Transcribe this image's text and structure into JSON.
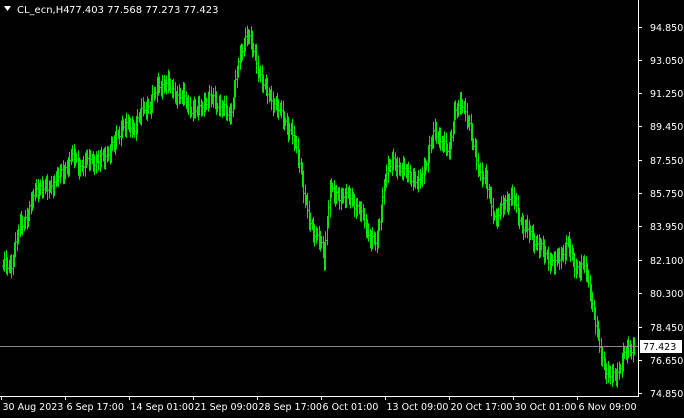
{
  "window": {
    "symbol_label": "CL_ecn,H4",
    "ohlc_label": "77.403 77.568 77.273 77.423",
    "menu_icon": "triangle-down-icon"
  },
  "colors": {
    "background": "#000000",
    "bars": "#00e600",
    "axis": "#ffffff",
    "text": "#ffffff",
    "price_line": "#8c8c8c",
    "price_tag_bg": "#ffffff",
    "price_tag_text": "#000000"
  },
  "price_tag": {
    "value": 77.423,
    "label": "77.423"
  },
  "chart_data": {
    "type": "bar",
    "instrument": "CL_ecn",
    "timeframe": "H4",
    "y_ticks": [
      94.85,
      93.05,
      91.25,
      89.45,
      87.55,
      85.75,
      83.95,
      82.1,
      80.3,
      78.45,
      76.65,
      74.85
    ],
    "y_tick_labels": [
      "94.850",
      "93.050",
      "91.250",
      "89.450",
      "87.550",
      "85.750",
      "83.950",
      "82.100",
      "80.300",
      "78.450",
      "76.650",
      "74.850"
    ],
    "x_tick_labels": [
      "30 Aug 2023",
      "6 Sep 17:00",
      "14 Sep 01:00",
      "21 Sep 09:00",
      "28 Sep 17:00",
      "6 Oct 01:00",
      "13 Oct 09:00",
      "20 Oct 17:00",
      "30 Oct 01:00",
      "6 Nov 09:00"
    ],
    "ylim": [
      74.7,
      96.3
    ],
    "close_anchors": [
      [
        0,
        81.8
      ],
      [
        6,
        81.9
      ],
      [
        12,
        84.0
      ],
      [
        18,
        84.6
      ],
      [
        24,
        86.1
      ],
      [
        32,
        86.0
      ],
      [
        38,
        86.5
      ],
      [
        44,
        87.0
      ],
      [
        50,
        87.8
      ],
      [
        56,
        87.2
      ],
      [
        62,
        87.6
      ],
      [
        70,
        87.5
      ],
      [
        80,
        88.4
      ],
      [
        86,
        89.5
      ],
      [
        94,
        89.3
      ],
      [
        100,
        90.2
      ],
      [
        106,
        90.6
      ],
      [
        112,
        91.6
      ],
      [
        118,
        91.8
      ],
      [
        124,
        91.2
      ],
      [
        130,
        91.0
      ],
      [
        134,
        90.5
      ],
      [
        140,
        90.2
      ],
      [
        146,
        90.8
      ],
      [
        152,
        90.9
      ],
      [
        158,
        90.4
      ],
      [
        164,
        90.0
      ],
      [
        170,
        92.8
      ],
      [
        176,
        94.6
      ],
      [
        180,
        93.7
      ],
      [
        184,
        92.6
      ],
      [
        190,
        91.3
      ],
      [
        196,
        90.7
      ],
      [
        202,
        89.9
      ],
      [
        208,
        89.1
      ],
      [
        214,
        87.6
      ],
      [
        218,
        85.4
      ],
      [
        222,
        84.0
      ],
      [
        228,
        83.3
      ],
      [
        232,
        82.2
      ],
      [
        236,
        86.2
      ],
      [
        240,
        85.5
      ],
      [
        246,
        85.7
      ],
      [
        252,
        85.4
      ],
      [
        258,
        84.8
      ],
      [
        264,
        83.5
      ],
      [
        270,
        83.0
      ],
      [
        276,
        86.8
      ],
      [
        282,
        87.5
      ],
      [
        288,
        87.0
      ],
      [
        294,
        86.8
      ],
      [
        300,
        86.2
      ],
      [
        306,
        87.6
      ],
      [
        312,
        89.2
      ],
      [
        318,
        88.4
      ],
      [
        322,
        88.0
      ],
      [
        326,
        90.2
      ],
      [
        332,
        90.6
      ],
      [
        336,
        89.8
      ],
      [
        340,
        88.2
      ],
      [
        344,
        87.0
      ],
      [
        348,
        86.6
      ],
      [
        352,
        85.4
      ],
      [
        356,
        84.3
      ],
      [
        362,
        85.2
      ],
      [
        368,
        85.6
      ],
      [
        374,
        84.2
      ],
      [
        380,
        83.6
      ],
      [
        386,
        83.0
      ],
      [
        392,
        82.4
      ],
      [
        398,
        81.9
      ],
      [
        404,
        82.5
      ],
      [
        408,
        83.0
      ],
      [
        412,
        82.0
      ],
      [
        416,
        81.6
      ],
      [
        420,
        81.8
      ],
      [
        424,
        80.6
      ],
      [
        428,
        78.6
      ],
      [
        432,
        77.0
      ],
      [
        436,
        76.0
      ],
      [
        440,
        75.7
      ],
      [
        444,
        76.0
      ],
      [
        448,
        76.8
      ],
      [
        452,
        77.3
      ],
      [
        456,
        77.423
      ]
    ],
    "last_close": 77.423,
    "grid": false,
    "legend": "none"
  }
}
